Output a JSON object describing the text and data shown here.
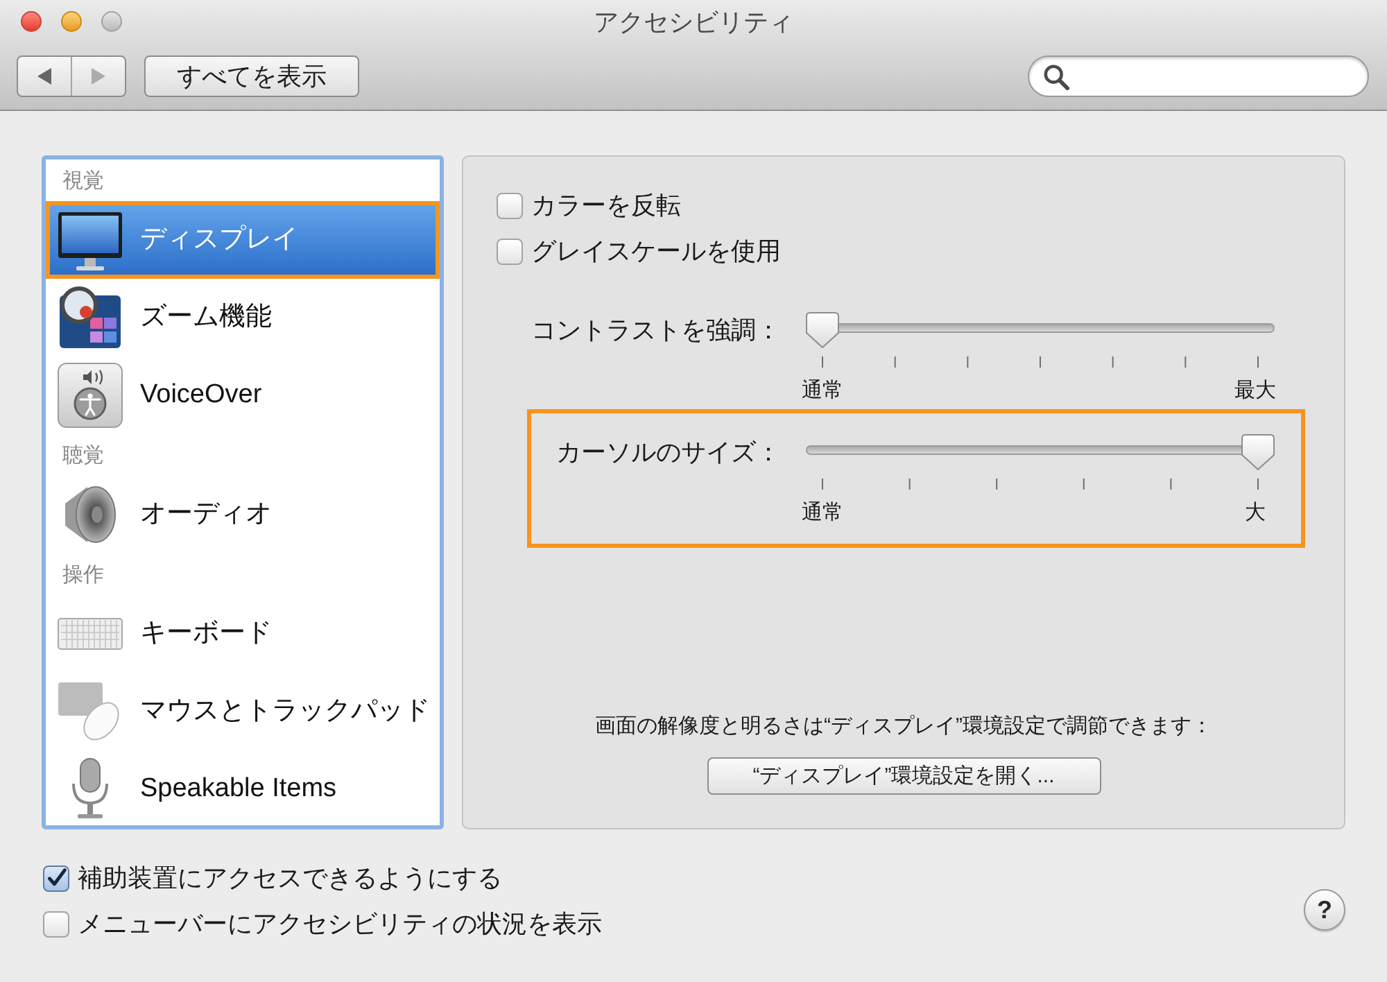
{
  "window": {
    "title": "アクセシビリティ"
  },
  "toolbar": {
    "show_all_button": "すべてを表示"
  },
  "sidebar": {
    "groups": [
      {
        "label": "視覚",
        "items": [
          {
            "label": "ディスプレイ",
            "selected": true,
            "highlighted": true
          },
          {
            "label": "ズーム機能",
            "selected": false,
            "highlighted": false
          },
          {
            "label": "VoiceOver",
            "selected": false,
            "highlighted": false
          }
        ]
      },
      {
        "label": "聴覚",
        "items": [
          {
            "label": "オーディオ",
            "selected": false,
            "highlighted": false
          }
        ]
      },
      {
        "label": "操作",
        "items": [
          {
            "label": "キーボード",
            "selected": false,
            "highlighted": false
          },
          {
            "label": "マウスとトラックパッド",
            "selected": false,
            "highlighted": false
          },
          {
            "label": "Speakable Items",
            "selected": false,
            "highlighted": false
          }
        ]
      }
    ]
  },
  "display_panel": {
    "checkboxes": [
      {
        "label": "カラーを反転",
        "checked": false
      },
      {
        "label": "グレイスケールを使用",
        "checked": false
      }
    ],
    "sliders": [
      {
        "label": "コントラストを強調：",
        "level": 0,
        "min_label": "通常",
        "max_label": "最大",
        "highlighted": false
      },
      {
        "label": "カーソルのサイズ：",
        "level": 1,
        "min_label": "通常",
        "max_label": "大",
        "highlighted": true
      }
    ],
    "note": "画面の解像度と明るさは“ディスプレイ”環境設定で調節できます：",
    "open_button": "“ディスプレイ”環境設定を開く..."
  },
  "footer": {
    "checkboxes": [
      {
        "label": "補助装置にアクセスできるようにする",
        "checked": true
      },
      {
        "label": "メニューバーにアクセシビリティの状況を表示",
        "checked": false
      }
    ],
    "help_button": "?"
  }
}
